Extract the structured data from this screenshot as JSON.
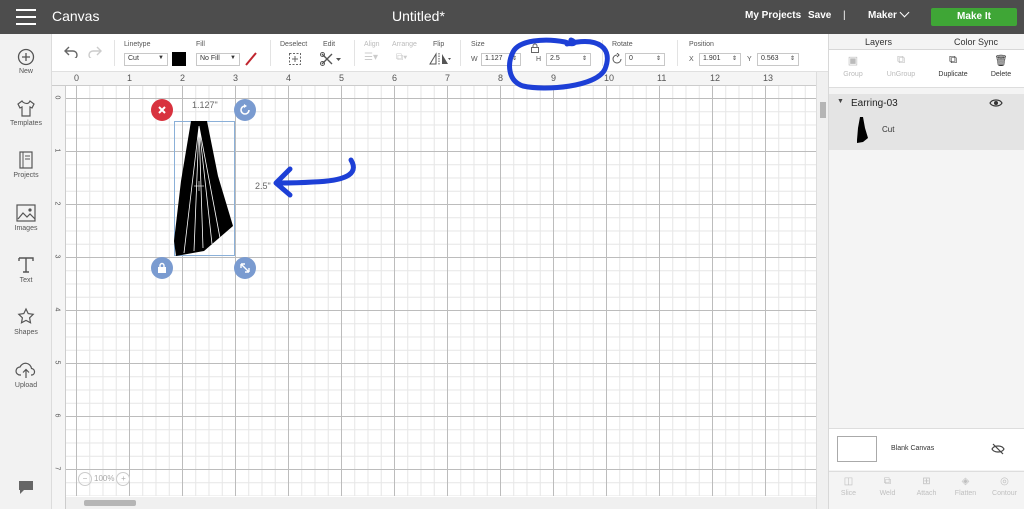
{
  "topbar": {
    "app_title": "Canvas",
    "doc_title": "Untitled*",
    "my_projects": "My Projects",
    "save": "Save",
    "divider": "|",
    "machine": "Maker",
    "make_it": "Make It"
  },
  "leftbar": {
    "items": [
      {
        "label": "New",
        "icon": "plus-circle-icon"
      },
      {
        "label": "Templates",
        "icon": "shirt-icon"
      },
      {
        "label": "Projects",
        "icon": "book-icon"
      },
      {
        "label": "Images",
        "icon": "image-icon"
      },
      {
        "label": "Text",
        "icon": "text-t-icon"
      },
      {
        "label": "Shapes",
        "icon": "shapes-icon"
      },
      {
        "label": "Upload",
        "icon": "cloud-upload-icon"
      }
    ],
    "chat_icon": "chat-bubble-icon"
  },
  "toolbar": {
    "linetype_label": "Linetype",
    "linetype_value": "Cut",
    "fill_label": "Fill",
    "fill_value": "No Fill",
    "deselect_label": "Deselect",
    "edit_label": "Edit",
    "align_label": "Align",
    "arrange_label": "Arrange",
    "flip_label": "Flip",
    "size_label": "Size",
    "w_label": "W",
    "w_value": "1.127",
    "h_label": "H",
    "h_value": "2.5",
    "rotate_label": "Rotate",
    "rotate_value": "0",
    "position_label": "Position",
    "x_label": "X",
    "x_value": "1.901",
    "y_label": "Y",
    "y_value": "0.563",
    "linetype_color": "#000000"
  },
  "ruler": {
    "top": [
      "0",
      "1",
      "2",
      "3",
      "4",
      "5",
      "6",
      "7",
      "8",
      "9",
      "10",
      "11",
      "12",
      "13"
    ],
    "left": [
      "0",
      "1",
      "2",
      "3",
      "4",
      "5",
      "6",
      "7"
    ]
  },
  "canvas": {
    "width_label": "1.127\"",
    "height_label": "2.5\"",
    "zoom": "100%",
    "zoom_out": "−",
    "zoom_in": "+"
  },
  "annotations": {
    "color": "#1d3fd6",
    "circle_target": "height-field",
    "arrow_target": "height-dimension-label"
  },
  "rightpanel": {
    "tabs": [
      "Layers",
      "Color Sync"
    ],
    "actions": [
      {
        "label": "Group",
        "enabled": false
      },
      {
        "label": "UnGroup",
        "enabled": false
      },
      {
        "label": "Duplicate",
        "enabled": true
      },
      {
        "label": "Delete",
        "enabled": true
      }
    ],
    "layer_group_name": "Earring-03",
    "layer_item_name": "Cut",
    "blank_canvas": "Blank Canvas",
    "bottom_actions": [
      "Slice",
      "Weld",
      "Attach",
      "Flatten",
      "Contour"
    ]
  },
  "colors": {
    "topbar": "#4d4d4d",
    "make_it": "#3fa636",
    "delete_handle": "#d8323e",
    "handle_blue": "#7a9bd0"
  }
}
